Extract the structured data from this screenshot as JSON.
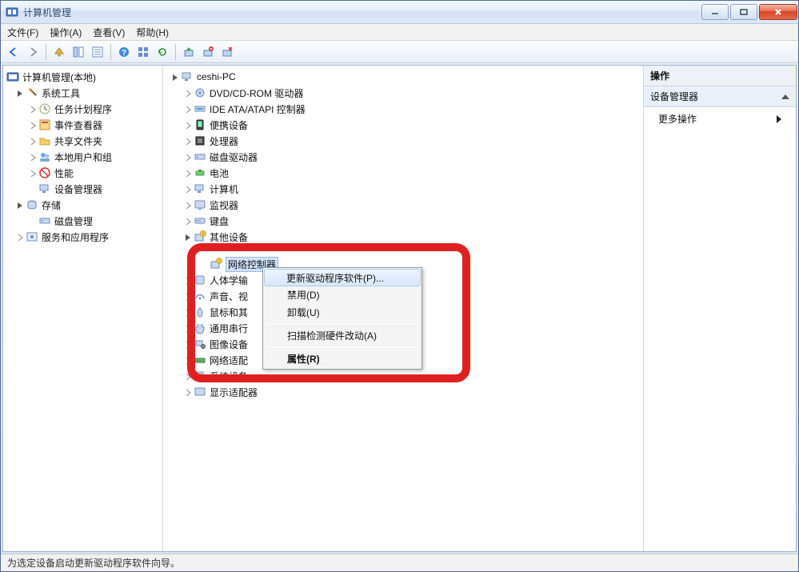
{
  "window": {
    "title": "计算机管理"
  },
  "menubar": [
    "文件(F)",
    "操作(A)",
    "查看(V)",
    "帮助(H)"
  ],
  "left_tree": {
    "root": "计算机管理(本地)",
    "system_tools": {
      "label": "系统工具",
      "children": [
        "任务计划程序",
        "事件查看器",
        "共享文件夹",
        "本地用户和组",
        "性能",
        "设备管理器"
      ]
    },
    "storage": {
      "label": "存储",
      "children": [
        "磁盘管理"
      ]
    },
    "services": {
      "label": "服务和应用程序"
    }
  },
  "device_tree": {
    "root": "ceshi-PC",
    "categories": [
      "DVD/CD-ROM 驱动器",
      "IDE ATA/ATAPI 控制器",
      "便携设备",
      "处理器",
      "磁盘驱动器",
      "电池",
      "计算机",
      "监视器",
      "键盘"
    ],
    "other_devices": {
      "label": "其他设备",
      "child": "网络控制器"
    },
    "post_categories": [
      "人体学输",
      "声音、视",
      "鼠标和其",
      "通用串行",
      "图像设备",
      "网络适配",
      "系统设备",
      "显示适配器"
    ]
  },
  "context_menu": {
    "items": [
      "更新驱动程序软件(P)...",
      "禁用(D)",
      "卸载(U)"
    ],
    "scan": "扫描检测硬件改动(A)",
    "properties": "属性(R)"
  },
  "right_pane": {
    "header": "操作",
    "section": "设备管理器",
    "more": "更多操作"
  },
  "statusbar": "为选定设备启动更新驱动程序软件向导。"
}
